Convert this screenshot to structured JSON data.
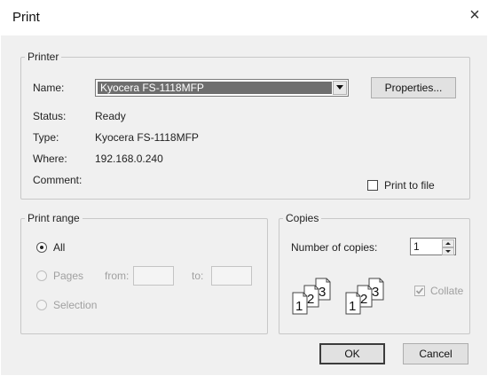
{
  "window": {
    "title": "Print",
    "close_glyph": "×"
  },
  "printer": {
    "group_label": "Printer",
    "name_label": "Name:",
    "selected_printer": "Kyocera FS-1118MFP",
    "properties_label": "Properties...",
    "status_label": "Status:",
    "status_value": "Ready",
    "type_label": "Type:",
    "type_value": "Kyocera FS-1118MFP",
    "where_label": "Where:",
    "where_value": "192.168.0.240",
    "comment_label": "Comment:",
    "comment_value": "",
    "print_to_file_label": "Print to file",
    "print_to_file_checked": false
  },
  "print_range": {
    "group_label": "Print range",
    "all_label": "All",
    "pages_label": "Pages",
    "from_label": "from:",
    "to_label": "to:",
    "from_value": "",
    "to_value": "",
    "selection_label": "Selection",
    "selected": "All"
  },
  "copies": {
    "group_label": "Copies",
    "number_label": "Number of copies:",
    "number_value": "1",
    "collate_label": "Collate",
    "collate_checked": true,
    "collate_icon_pages": [
      "1",
      "2",
      "3"
    ]
  },
  "buttons": {
    "ok_label": "OK",
    "cancel_label": "Cancel"
  },
  "colors": {
    "selection_bg": "#6e6e6e",
    "dialog_bg": "#f0f0f0",
    "disabled_text": "#a0a0a0"
  }
}
